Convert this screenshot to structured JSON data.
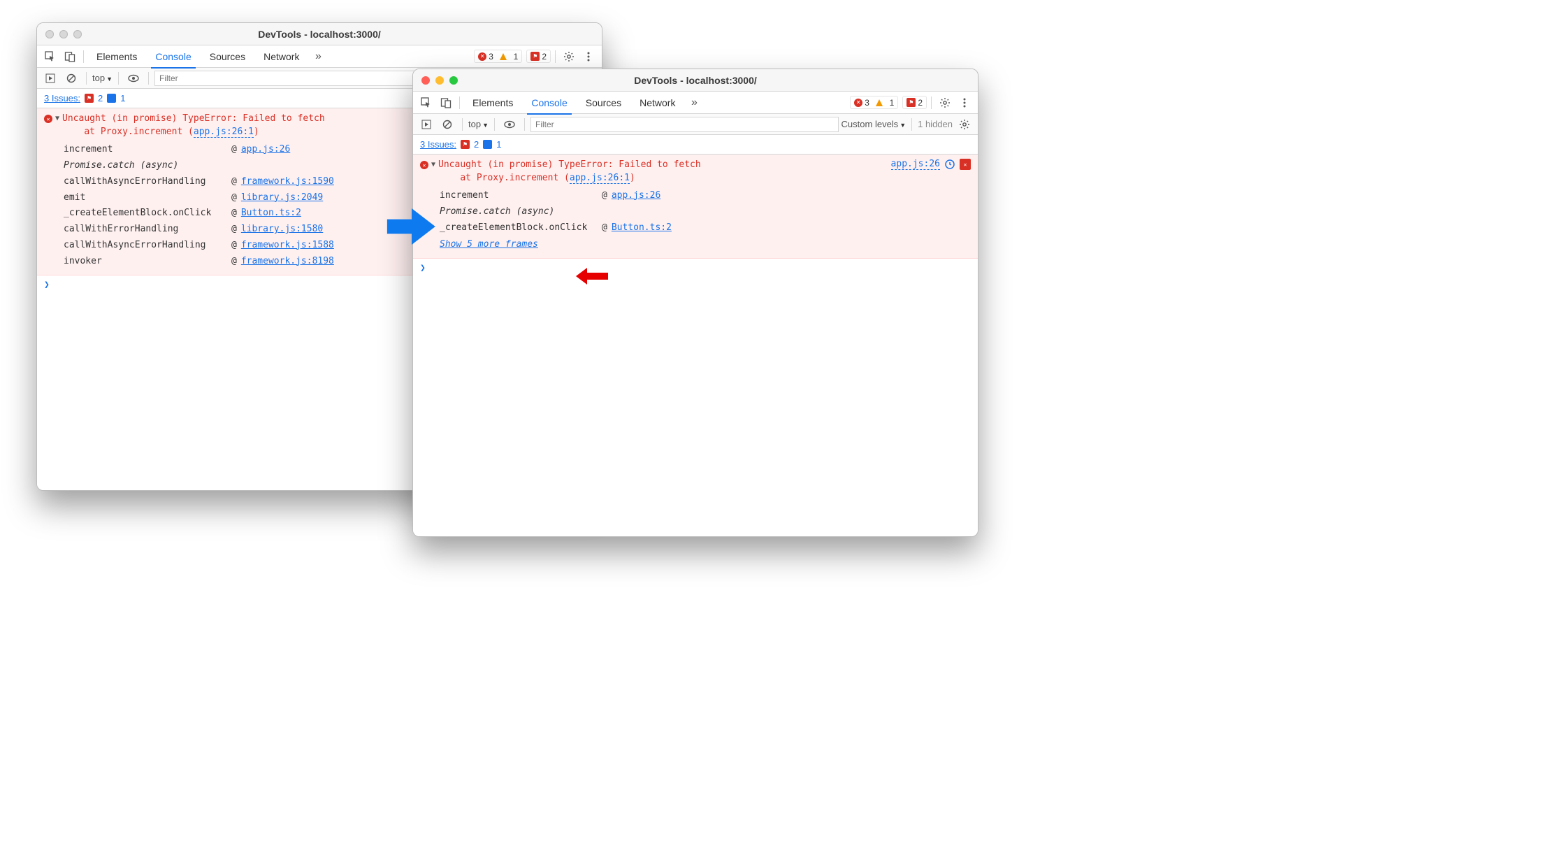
{
  "left": {
    "title": "DevTools - localhost:3000/",
    "traffic_gray": true,
    "tabs": [
      "Elements",
      "Console",
      "Sources",
      "Network"
    ],
    "active_tab": "Console",
    "counts": {
      "errors": "3",
      "warnings": "1",
      "issues": "2"
    },
    "sub": {
      "context": "top",
      "filter_placeholder": "Filter"
    },
    "issues": {
      "label": "3 Issues:",
      "flag_count": "2",
      "msg_count": "1"
    },
    "error": {
      "message": "Uncaught (in promise) TypeError: Failed to fetch\n    at Proxy.increment (",
      "loc_text": "app.js:26:1",
      "close": ")",
      "stack": [
        {
          "fn": "increment",
          "src": "app.js:26"
        },
        {
          "async": "Promise.catch (async)"
        },
        {
          "fn": "callWithAsyncErrorHandling",
          "src": "framework.js:1590"
        },
        {
          "fn": "emit",
          "src": "library.js:2049"
        },
        {
          "fn": "_createElementBlock.onClick",
          "src": "Button.ts:2"
        },
        {
          "fn": "callWithErrorHandling",
          "src": "library.js:1580"
        },
        {
          "fn": "callWithAsyncErrorHandling",
          "src": "framework.js:1588"
        },
        {
          "fn": "invoker",
          "src": "framework.js:8198"
        }
      ]
    }
  },
  "right": {
    "title": "DevTools - localhost:3000/",
    "traffic_gray": false,
    "tabs": [
      "Elements",
      "Console",
      "Sources",
      "Network"
    ],
    "active_tab": "Console",
    "counts": {
      "errors": "3",
      "warnings": "1",
      "issues": "2"
    },
    "sub": {
      "context": "top",
      "filter_placeholder": "Filter",
      "levels": "Custom levels",
      "hidden": "1 hidden"
    },
    "issues": {
      "label": "3 Issues:",
      "flag_count": "2",
      "msg_count": "1"
    },
    "error": {
      "message": "Uncaught (in promise) TypeError: Failed to fetch\n    at Proxy.increment (",
      "loc_text": "app.js:26:1",
      "close": ")",
      "right_src": "app.js:26",
      "stack": [
        {
          "fn": "increment",
          "src": "app.js:26"
        },
        {
          "async": "Promise.catch (async)"
        },
        {
          "fn": "_createElementBlock.onClick",
          "src": "Button.ts:2"
        }
      ],
      "show_more": "Show 5 more frames"
    }
  },
  "at_symbol": "@"
}
